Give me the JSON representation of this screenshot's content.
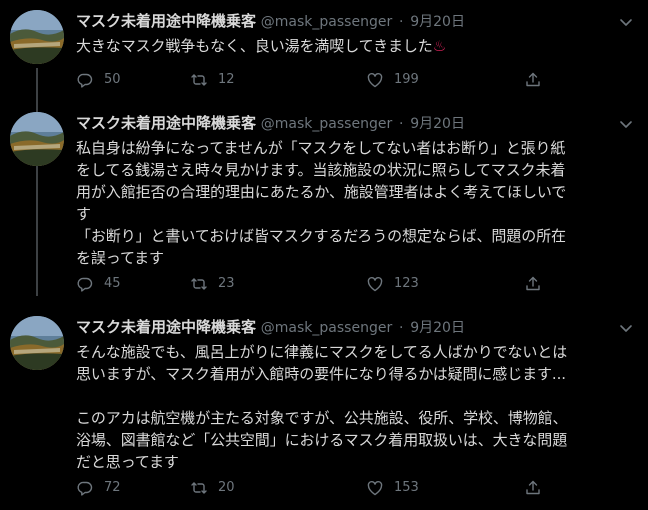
{
  "colors": {
    "background": "#000000",
    "text": "#d9d9d9",
    "muted": "#6e767d",
    "thread_line": "#3d4144",
    "emoji": "#e0245e"
  },
  "tweets": [
    {
      "name": "マスク未着用途中降機乗客",
      "handle": "@mask_passenger",
      "separator": "·",
      "date": "9月20日",
      "text": "大きなマスク戦争もなく、良い湯を満喫してきました",
      "emoji": "♨",
      "emoji_icon": "hot-springs-icon",
      "replies": "50",
      "retweets": "12",
      "likes": "199"
    },
    {
      "name": "マスク未着用途中降機乗客",
      "handle": "@mask_passenger",
      "separator": "·",
      "date": "9月20日",
      "text": "私自身は紛争になってませんが「マスクをしてない者はお断り」と張り紙\nをしてる銭湯さえ時々見かけます。当該施設の状況に照らしてマスク未着\n用が入館拒否の合理的理由にあたるか、施設管理者はよく考えてほしいで\nす\n「お断り」と書いておけば皆マスクするだろうの想定ならば、問題の所在\nを誤ってます",
      "replies": "45",
      "retweets": "23",
      "likes": "123"
    },
    {
      "name": "マスク未着用途中降機乗客",
      "handle": "@mask_passenger",
      "separator": "·",
      "date": "9月20日",
      "text": "そんな施設でも、風呂上がりに律義にマスクをしてる人ばかりでないとは\n思いますが、マスク着用が入館時の要件になり得るかは疑問に感じます...\n\nこのアカは航空機が主たる対象ですが、公共施設、役所、学校、博物館、\n浴場、図書館など「公共空間」におけるマスク着用取扱いは、大きな問題\nだと思ってます",
      "replies": "72",
      "retweets": "20",
      "likes": "153"
    }
  ],
  "icons": {
    "avatar": "landscape-avatar",
    "menu": "chevron-down-icon",
    "reply": "reply-icon",
    "retweet": "retweet-icon",
    "like": "heart-icon",
    "share": "share-icon"
  }
}
